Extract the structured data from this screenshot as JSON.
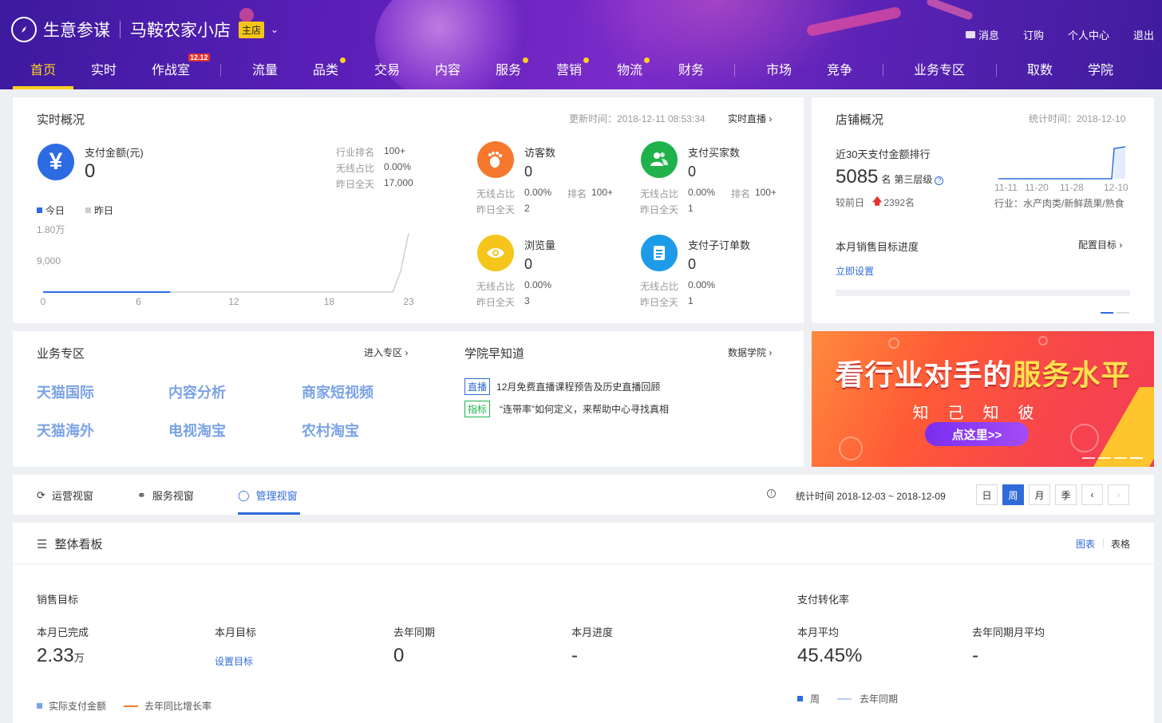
{
  "header": {
    "app_title": "生意参谋",
    "shop_name": "马鞍农家小店",
    "shop_badge": "主店",
    "links": [
      "消息",
      "订购",
      "个人中心",
      "退出"
    ],
    "nav": [
      "首页",
      "实时",
      "作战室",
      "流量",
      "品类",
      "交易",
      "内容",
      "服务",
      "营销",
      "物流",
      "财务",
      "市场",
      "竞争",
      "业务专区",
      "取数",
      "学院"
    ],
    "nav_tag": "12.12"
  },
  "realtime": {
    "title": "实时概况",
    "update_time": "更新时间：2018-12-11 08:53:34",
    "live_link": "实时直播",
    "pay": {
      "label": "支付金额(元)",
      "value": "0",
      "industry_rank_label": "行业排名",
      "industry_rank": "100+",
      "wireless_label": "无线占比",
      "wireless": "0.00%",
      "yesterday_label": "昨日全天",
      "yesterday": "17,000"
    },
    "legend": {
      "today": "今日",
      "yesterday": "昨日"
    },
    "metrics": [
      {
        "label": "访客数",
        "value": "0",
        "wireless_label": "无线占比",
        "wireless": "0.00%",
        "rank_label": "排名",
        "rank": "100+",
        "yesterday_label": "昨日全天",
        "yesterday": "2"
      },
      {
        "label": "支付买家数",
        "value": "0",
        "wireless_label": "无线占比",
        "wireless": "0.00%",
        "rank_label": "排名",
        "rank": "100+",
        "yesterday_label": "昨日全天",
        "yesterday": "1"
      },
      {
        "label": "浏览量",
        "value": "0",
        "wireless_label": "无线占比",
        "wireless": "0.00%",
        "yesterday_label": "昨日全天",
        "yesterday": "3"
      },
      {
        "label": "支付子订单数",
        "value": "0",
        "wireless_label": "无线占比",
        "wireless": "0.00%",
        "yesterday_label": "昨日全天",
        "yesterday": "1"
      }
    ],
    "colors": {
      "pay": "#2d6be2",
      "visitors": "#f6782f",
      "buyers": "#1fb24a",
      "pv": "#f6c51b",
      "orders": "#1e9be8"
    }
  },
  "chart_data": {
    "type": "line",
    "x": [
      0,
      6,
      12,
      18,
      23
    ],
    "xticks": [
      "0",
      "6",
      "12",
      "18",
      "23"
    ],
    "yticks": [
      "1.80万",
      "9,000"
    ],
    "ylim": [
      0,
      18000
    ],
    "series": [
      {
        "name": "今日",
        "x": [
          0,
          1,
          2,
          3,
          4,
          5,
          6,
          7,
          8
        ],
        "values": [
          0,
          0,
          0,
          0,
          0,
          0,
          0,
          0,
          0
        ]
      },
      {
        "name": "昨日",
        "x": [
          0,
          6,
          12,
          18,
          20,
          21,
          22,
          22.5,
          23
        ],
        "values": [
          0,
          0,
          0,
          0,
          0,
          0,
          0,
          6000,
          17000
        ]
      }
    ]
  },
  "shop": {
    "title": "店铺概况",
    "stat_time": "统计时间：2018-12-10",
    "rank_title": "近30天支付金额排行",
    "rank_value": "5085",
    "rank_unit": "名",
    "rank_level": "第三层级",
    "prev_label": "较前日",
    "prev_change": "2392名",
    "trend_ticks": [
      "11-11",
      "11-20",
      "11-28",
      "12-10"
    ],
    "industry": "行业：水产肉类/新鲜蔬果/熟食",
    "target_title": "本月销售目标进度",
    "config_link": "配置目标",
    "set_now": "立即设置"
  },
  "business": {
    "title": "业务专区",
    "enter_link": "进入专区",
    "items": [
      "天猫国际",
      "内容分析",
      "商家短视频",
      "天猫海外",
      "电视淘宝",
      "农村淘宝"
    ]
  },
  "academy": {
    "title": "学院早知道",
    "link": "数据学院",
    "news": [
      {
        "tag": "直播",
        "text": "12月免费直播课程预告及历史直播回顾"
      },
      {
        "tag": "指标",
        "text": "“连带率”如何定义，来帮助中心寻找真相"
      }
    ]
  },
  "banner": {
    "title_a": "看行业对手的",
    "title_b": "服务水平",
    "subtitle": "知己知彼",
    "button": "点这里>>"
  },
  "viewtabs": {
    "tabs": [
      "运营视窗",
      "服务视窗",
      "管理视窗"
    ],
    "stat_range": "统计时间 2018-12-03 ~ 2018-12-09",
    "periods": [
      "日",
      "周",
      "月",
      "季"
    ],
    "active_period": "周"
  },
  "board": {
    "title": "整体看板",
    "view_chart": "图表",
    "view_table": "表格",
    "sales_title": "销售目标",
    "conv_title": "支付转化率",
    "sales": [
      {
        "label": "本月已完成",
        "value": "2.33",
        "unit": "万"
      },
      {
        "label": "本月目标",
        "value": "设置目标"
      },
      {
        "label": "去年同期",
        "value": "0"
      },
      {
        "label": "本月进度",
        "value": "-"
      }
    ],
    "conv": [
      {
        "label": "本月平均",
        "value": "45.45%"
      },
      {
        "label": "去年同期月平均",
        "value": "-"
      }
    ],
    "legend_sales": [
      "实际支付金额",
      "去年同比增长率"
    ],
    "legend_conv": [
      "周",
      "去年同期"
    ]
  }
}
